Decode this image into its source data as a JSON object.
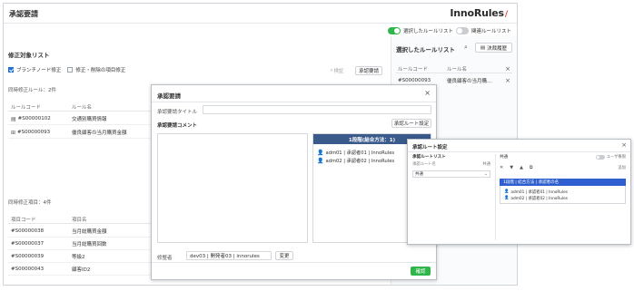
{
  "app": {
    "title": "承認要請",
    "logo": "InnoRules",
    "logo_mark": "∕"
  },
  "toggles": [
    {
      "label": "選択したルールリスト",
      "on": true
    },
    {
      "label": "関連ルールリスト",
      "on": false
    }
  ],
  "left": {
    "section_title": "修正対象リスト",
    "checkbox_a": "ブランチノード修正",
    "checkbox_b": "修正・削除の項目修正",
    "btn_verify": "検証",
    "btn_request": "承認要請",
    "rule_count": "同時修正ルール：2件",
    "rule_columns": [
      "ルールコード",
      "ルール名"
    ],
    "rule_rows": [
      {
        "code": "#S00000102",
        "name": "交通別購買情報",
        "icon": "table-icon"
      },
      {
        "code": "#S00000093",
        "name": "優良顧客の当月購買金額",
        "icon": "tree-icon"
      }
    ],
    "item_count": "同時修正項目：4件",
    "item_columns": [
      "項目コード",
      "項目名"
    ],
    "item_rows": [
      {
        "code": "#S00000038",
        "name": "当月総購買金額"
      },
      {
        "code": "#S00000037",
        "name": "当月総購買回数"
      },
      {
        "code": "#S00000039",
        "name": "等級2"
      },
      {
        "code": "#S00000043",
        "name": "顧客ID2"
      }
    ]
  },
  "right": {
    "title": "選択したルールリスト",
    "btn_history": "決裁履歴",
    "columns": [
      "ルールコード",
      "ルール名"
    ],
    "rows": [
      {
        "code": "#S00000093",
        "name": "優良顧客の当月購…"
      }
    ]
  },
  "approval_dialog": {
    "title": "承認要請",
    "title_field_label": "承認要請タイトル",
    "title_field_value": "",
    "comment_label": "承認要請コメント",
    "route_button": "承認ルート設定",
    "route_header": "1段階(結合方法：1)",
    "route_items": [
      "adm01 | 承認者01 | InnoRules",
      "adm02 | 承認者02 | InnoRules"
    ],
    "editor_label": "修整者",
    "editor_value": "dev03 | 開発者03 | innorules",
    "change_button": "変更",
    "confirm_button": "確認"
  },
  "route_dialog": {
    "title": "承認ルート設定",
    "left_title": "承認ルートリスト",
    "left_col_name": "承認ルート名",
    "left_col_type": "共通",
    "left_select_value": "共通",
    "right_label": "共通",
    "toggle_label": "ユーザ権限",
    "add_label": "追加",
    "blue_bar": "1段階  | 結合方法  | 承認者の名",
    "items": [
      "adm01 | 承認者01 | InnoRules",
      "adm02 | 承認者02 | InnoRules"
    ]
  }
}
